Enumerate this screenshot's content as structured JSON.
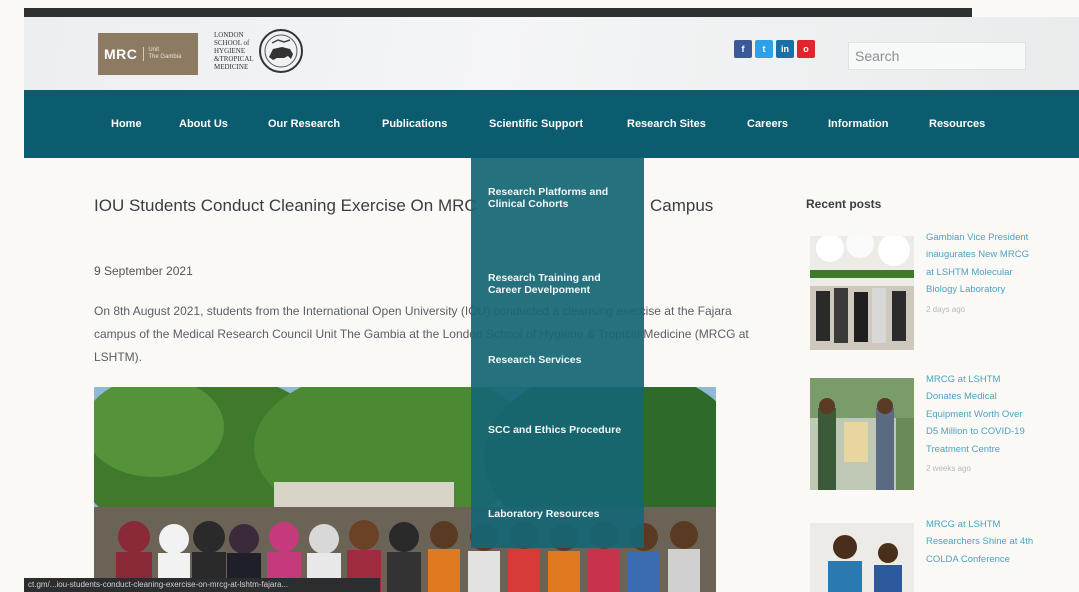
{
  "header": {
    "mrc_logo": {
      "text": "MRC",
      "sub_line1": "Unit",
      "sub_line2": "The Gambia"
    },
    "lshtm_logo": {
      "lines": [
        "LONDON",
        "SCHOOL of",
        "HYGIENE",
        "&TROPICAL",
        "MEDICINE"
      ]
    },
    "socials": [
      {
        "label": "f",
        "color": "#3b5998",
        "icon": "facebook-icon"
      },
      {
        "label": "t",
        "color": "#2ea0e8",
        "icon": "twitter-icon"
      },
      {
        "label": "in",
        "color": "#1b6fa8",
        "icon": "linkedin-icon"
      },
      {
        "label": "o",
        "color": "#e4242c",
        "icon": "instagram-icon"
      }
    ],
    "search": {
      "placeholder": "Search"
    }
  },
  "nav": {
    "items": [
      "Home",
      "About Us",
      "Our Research",
      "Publications",
      "Scientific Support",
      "Research Sites",
      "Careers",
      "Information",
      "Resources"
    ]
  },
  "dropdown": {
    "items": [
      "Research Platforms and Clinical Cohorts",
      "Research Training and Career Develpoment",
      "Research Services",
      "SCC and Ethics Procedure",
      "Laboratory Resources"
    ]
  },
  "article": {
    "title_start": "IOU Students Conduct Cleaning Exercise On MRC",
    "title_end": "Campus",
    "date": "9 September 2021",
    "body": "On 8th August 2021, students from the International Open University (IOU) conducted a cleansing exercise at the Fajara campus of the Medical Research Council Unit The Gambia at the London School of Hygiene & Tropical Medicine (MRCG at LSHTM)."
  },
  "sidebar": {
    "title": "Recent posts",
    "posts": [
      {
        "title": "Gambian Vice President inaugurates New MRCG at LSHTM Molecular Biology Laboratory",
        "meta": "2 days ago"
      },
      {
        "title": "MRCG at LSHTM Donates Medical Equipment Worth Over D5 Million to COVID-19 Treatment Centre",
        "meta": "2 weeks ago"
      },
      {
        "title": "MRCG at LSHTM Researchers Shine at 4th COLDA Conference",
        "meta": ""
      }
    ]
  },
  "status_bar": {
    "url": "ct.gm/...iou-students-conduct-cleaning-exercise-on-mrcg-at-lshtm-fajara..."
  },
  "colors": {
    "nav_bg": "#0b5c6e",
    "dropdown_bg": "#166674",
    "link": "#4aa3c4"
  }
}
